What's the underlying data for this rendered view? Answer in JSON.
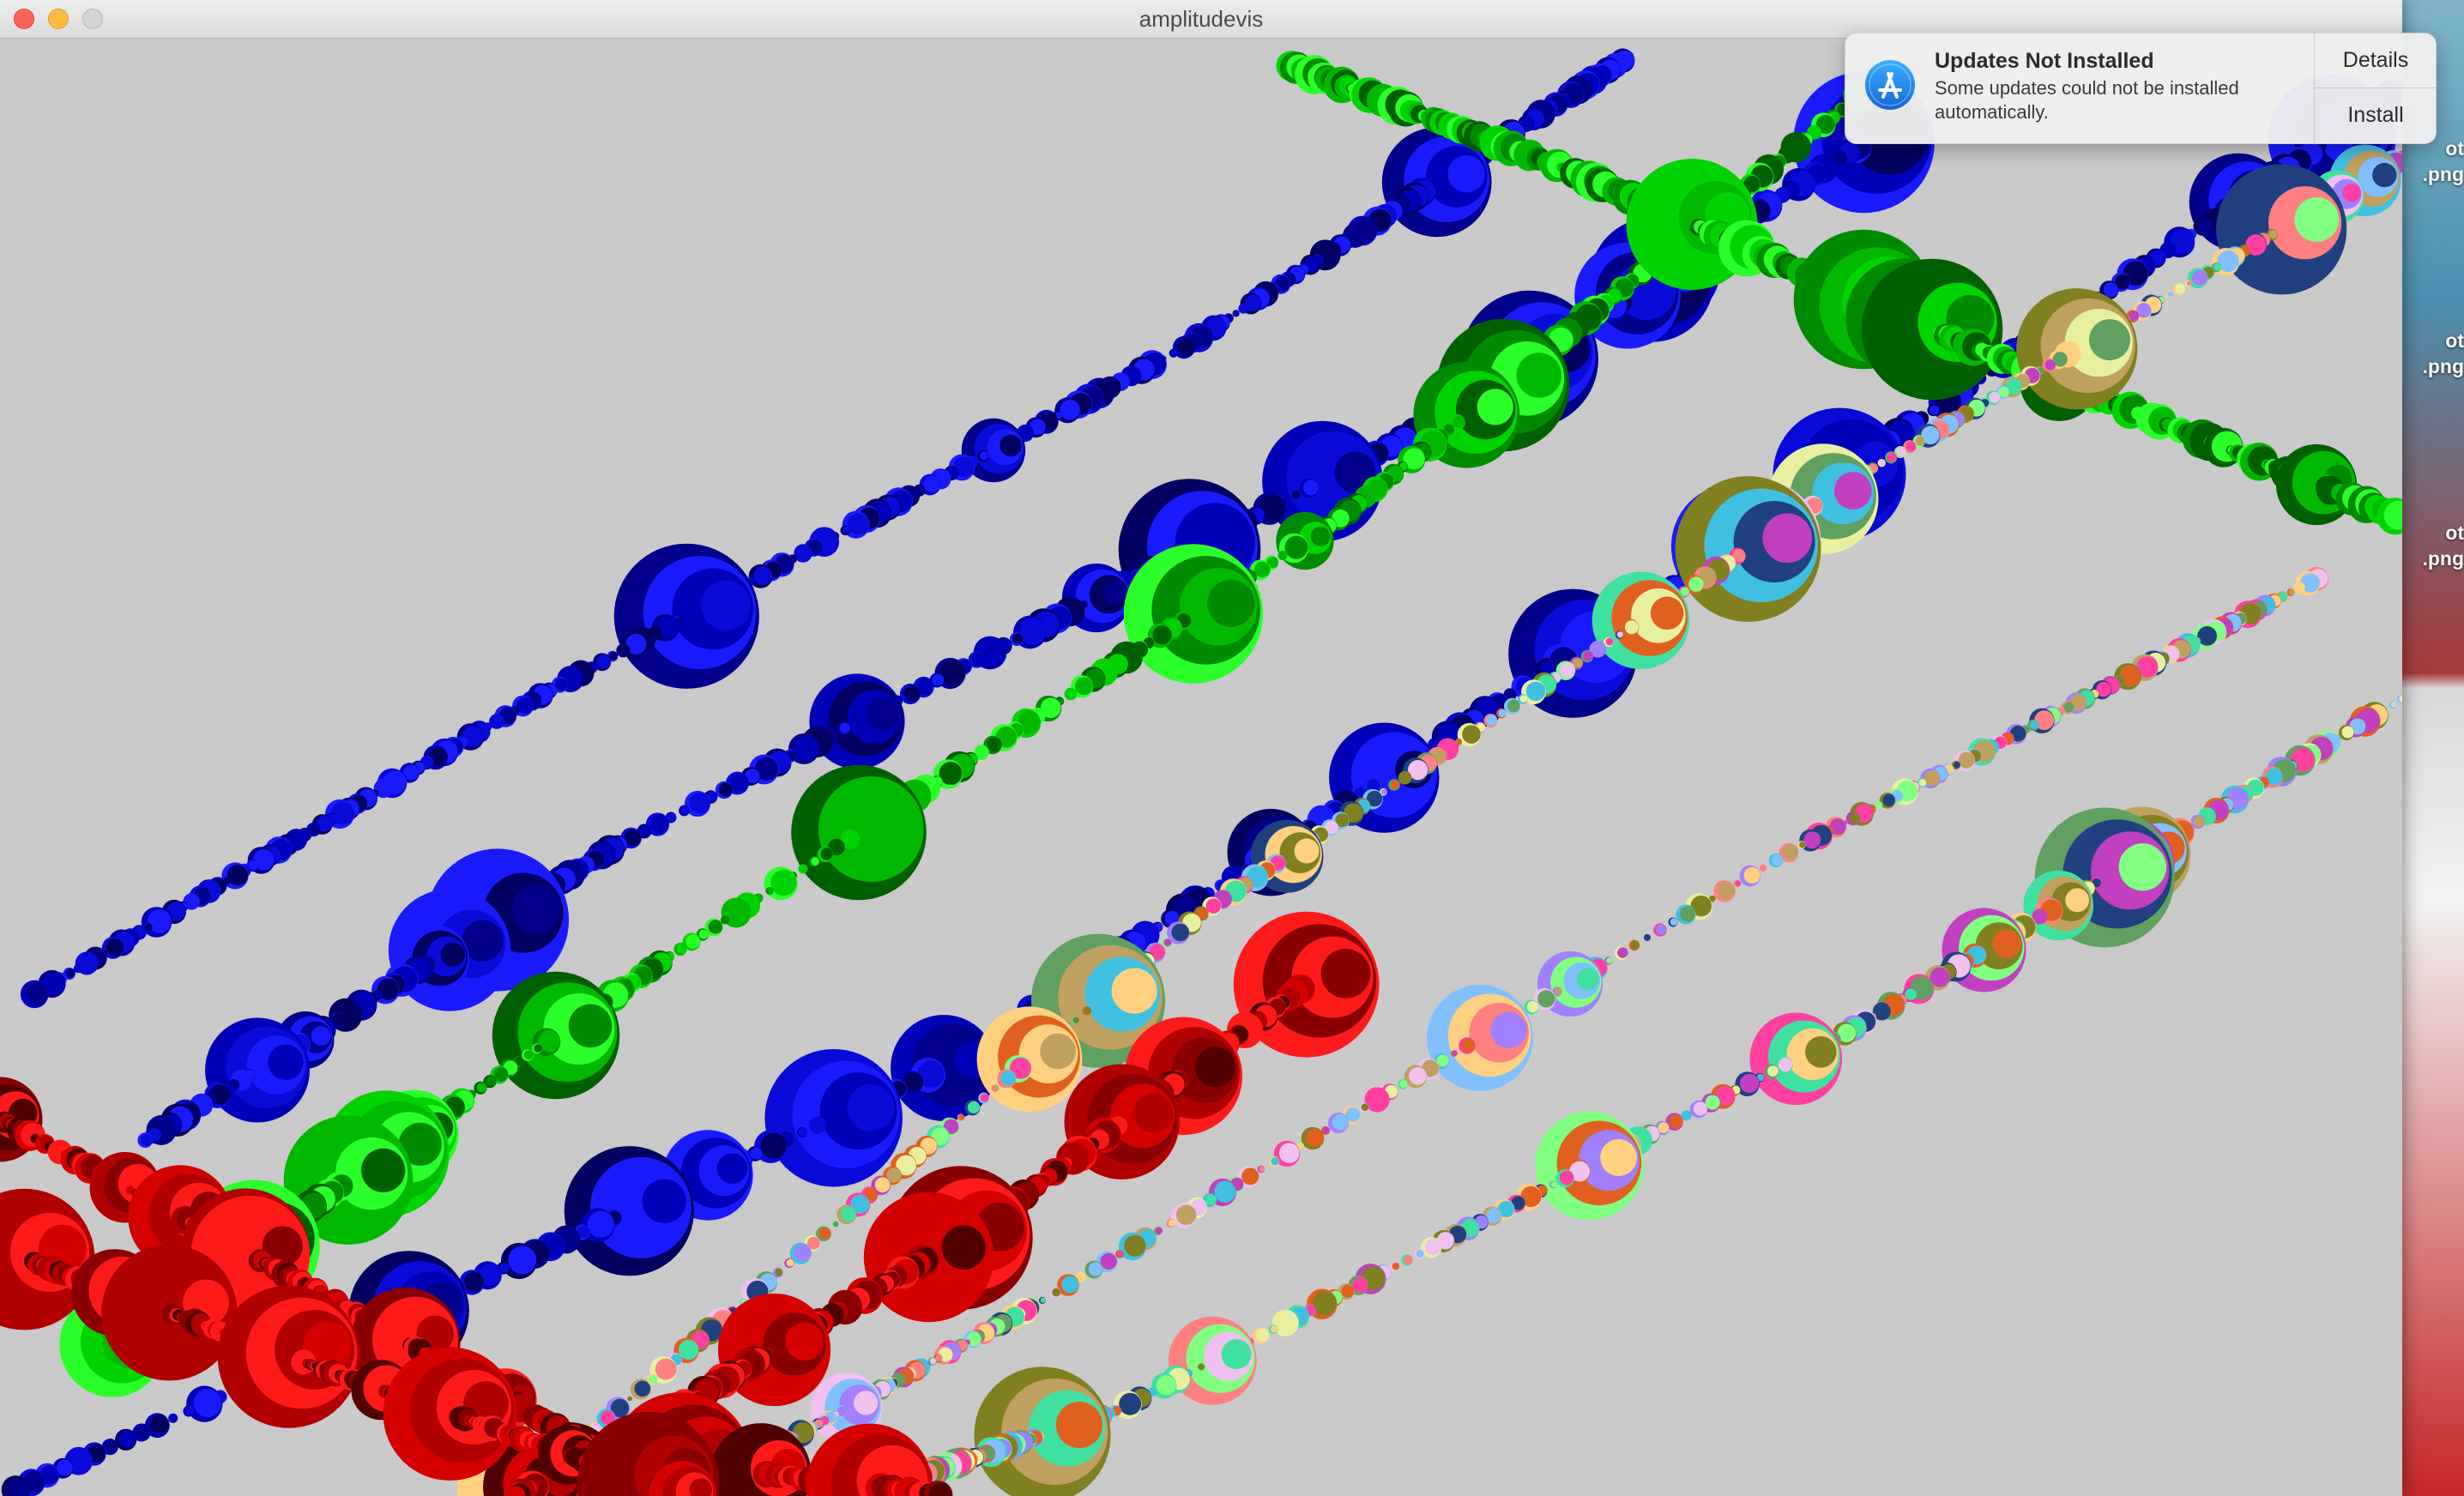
{
  "window": {
    "title": "amplitudevis"
  },
  "notification": {
    "title": "Updates Not Installed",
    "body": "Some updates could not be installed automatically.",
    "details_label": "Details",
    "install_label": "Install",
    "icon": "app-store-icon",
    "accent_color": "#1f7ff0"
  },
  "desktop": {
    "partial_labels": [
      {
        "line1": "ot",
        "line2": ".png"
      },
      {
        "line1": "ot",
        "line2": ".png"
      },
      {
        "line1": "ot",
        "line2": ".png"
      }
    ]
  },
  "visualization": {
    "background": "#c9c9c9",
    "palette": {
      "blue": [
        "#0a0ad8",
        "#00008a",
        "#0000b8",
        "#1a1aff",
        "#000060"
      ],
      "green": [
        "#00b800",
        "#008a00",
        "#00d400",
        "#006000",
        "#2aff2a"
      ],
      "red": [
        "#d40000",
        "#8a0000",
        "#ff1a1a",
        "#500000",
        "#b00000"
      ],
      "mixed": [
        "#e8f0a0",
        "#c040c0",
        "#40c0e0",
        "#ff8080",
        "#80ff80",
        "#ffd080",
        "#a080ff",
        "#40e0a0",
        "#e06020",
        "#204080",
        "#808020",
        "#f0c0f0",
        "#60a060",
        "#ff40a0",
        "#80c0ff",
        "#c0a060"
      ]
    }
  }
}
